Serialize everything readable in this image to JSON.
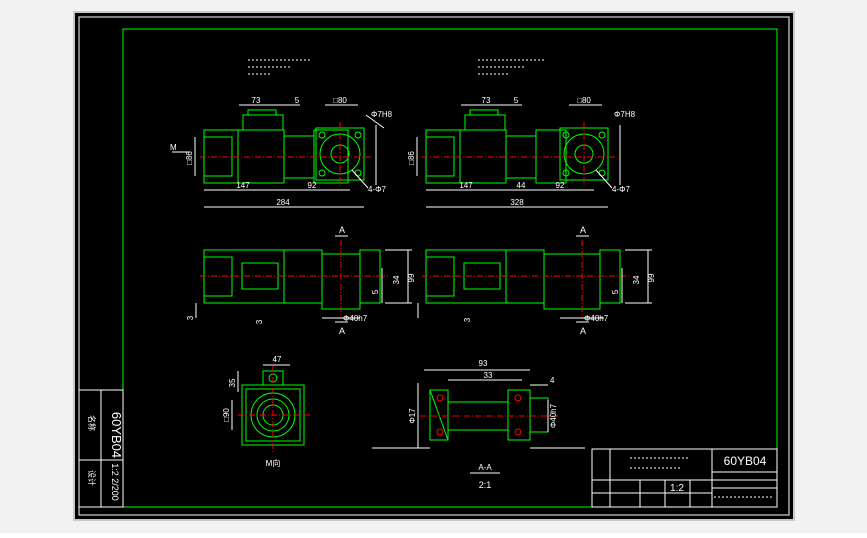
{
  "drawing": {
    "colors": {
      "background": "#000000",
      "frame": "#ffffff",
      "border": "#00ff00",
      "part": "#00ff00",
      "dimension": "#ffffff",
      "centerline": "#ff0000",
      "titleblock": "#ffffff"
    },
    "views": {
      "view1": {
        "dim_top_73": "73",
        "dim_top_5": "5",
        "dim_square": "□80",
        "dim_dia": "Φ7H8",
        "dim_left": "□86",
        "dim_bottom_147": "147",
        "dim_bottom_92": "92",
        "dim_total": "284",
        "dim_hole": "4-Φ7",
        "marker": "M"
      },
      "view2": {
        "dim_top_73": "73",
        "dim_top_5": "5",
        "dim_square": "□80",
        "dim_dia": "Φ7H8",
        "dim_left": "□86",
        "dim_bottom_147": "147",
        "dim_bottom_44": "44",
        "dim_bottom_92": "92",
        "dim_total": "328",
        "dim_hole": "4-Φ7"
      },
      "side1": {
        "section_a": "A",
        "dim_h1": "34",
        "dim_h2": "99",
        "dim_small": "5",
        "dim_small2": "3",
        "dim_hole": "Φ40h7",
        "dim_left": "3"
      },
      "side2": {
        "section_a": "A",
        "dim_h1": "34",
        "dim_h2": "99",
        "dim_small": "5",
        "dim_hole": "Φ40h7",
        "dim_left": "3"
      },
      "front": {
        "dim_47": "47",
        "dim_35": "35",
        "dim_square": "□90",
        "label": "M向"
      },
      "section": {
        "dim_93": "93",
        "dim_33": "33",
        "dim_small": "4",
        "dim_dia": "Φ17",
        "dim_dia2": "Φ40h7",
        "label": "A-A",
        "scale": "2:1"
      }
    },
    "title_block": {
      "drawing_no": "60YB04",
      "scale": "1:2",
      "side_no": "60YB04",
      "side_scale": "1:2 2/200"
    }
  }
}
